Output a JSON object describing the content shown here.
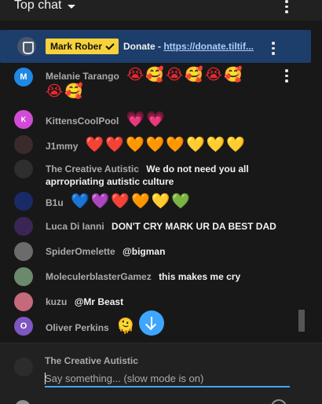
{
  "header": {
    "title": "Top chat",
    "menu_icon": "more-vert-icon"
  },
  "pinned": {
    "icon": "channel-logo-icon",
    "author": "Mark Rober",
    "text_prefix": "Donate - ",
    "link": "https://donate.tiltif...",
    "background": "#1d3d6b",
    "chip_color": "#f7d23b"
  },
  "messages": [
    {
      "author": "Melanie Tarango",
      "avatar_letter": "M",
      "avatar_color": "#1e88e5",
      "text": "",
      "emojis": "😭🥰😭🥰😭🥰",
      "emojis_line2": "😭🥰"
    },
    {
      "author": "KittensCoolPool",
      "avatar_letter": "K",
      "avatar_color": "#d14bd6",
      "text": "",
      "emojis": "💗💗"
    },
    {
      "author": "J1mmy",
      "avatar_letter": "",
      "avatar_color": "#3a2a2a",
      "text": "",
      "emojis": "❤️❤️🧡🧡🧡💛💛💛"
    },
    {
      "author": "The Creative Autistic",
      "avatar_letter": "",
      "avatar_color": "#2e2e2e",
      "text": "We do not need you all",
      "text_line2": "aprropriating autistic culture",
      "emojis": ""
    },
    {
      "author": "B1u",
      "avatar_letter": "",
      "avatar_color": "#1a2a66",
      "text": "",
      "emojis": "💙💜❤️🧡💛💚"
    },
    {
      "author": "Luca Di Ianni",
      "avatar_letter": "",
      "avatar_color": "#3a2655",
      "text": "DON'T CRY MARK UR DA BEST DAD",
      "emojis": ""
    },
    {
      "author": "SpiderOmelette",
      "avatar_letter": "",
      "avatar_color": "#6b6b6b",
      "text": "@bigman",
      "emojis": ""
    },
    {
      "author": "MoleculerblasterGamez",
      "avatar_letter": "",
      "avatar_color": "#6b8a6b",
      "text": "this makes me cry",
      "emojis": ""
    },
    {
      "author": "kuzu",
      "avatar_letter": "",
      "avatar_color": "#c46a7a",
      "text": "@Mr Beast",
      "emojis": ""
    },
    {
      "author": "Oliver Perkins",
      "avatar_letter": "O",
      "avatar_color": "#7e57c2",
      "text": "",
      "emojis": "🫠"
    }
  ],
  "composer": {
    "author": "The Creative Autistic",
    "placeholder": "Say something... (slow mode is on)"
  },
  "colors": {
    "background": "#181818",
    "accent": "#3ea6ff",
    "author_text": "#aaaaaa"
  }
}
